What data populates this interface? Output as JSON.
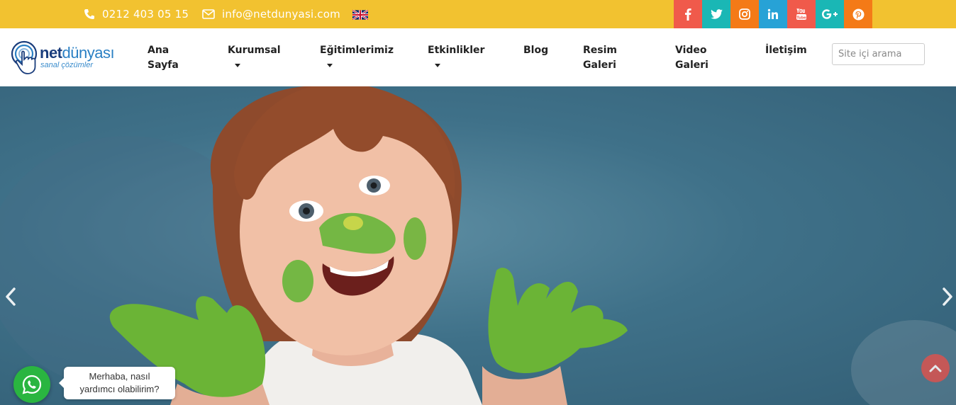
{
  "topbar": {
    "phone": "0212 403 05 15",
    "email": "info@netdunyasi.com",
    "language_flag": "uk-flag-icon",
    "socials": [
      {
        "name": "facebook",
        "glyph": "f",
        "color": "#f05a4b"
      },
      {
        "name": "twitter",
        "glyph": "t",
        "color": "#1ab7b5"
      },
      {
        "name": "instagram",
        "glyph": "i",
        "color": "#f47a17"
      },
      {
        "name": "linkedin",
        "glyph": "in",
        "color": "#27a2d6"
      },
      {
        "name": "youtube",
        "glyph": "yt",
        "color": "#f05a4b"
      },
      {
        "name": "google-plus",
        "glyph": "G+",
        "color": "#1ab7b5"
      },
      {
        "name": "pinterest",
        "glyph": "p",
        "color": "#f47a17"
      }
    ],
    "background": "#f2c230"
  },
  "logo": {
    "brand_bold": "net",
    "brand_light": "dünyası",
    "tagline": "sanal çözümler"
  },
  "nav": {
    "items": [
      {
        "line1": "Ana",
        "line2": "Sayfa",
        "dropdown": false
      },
      {
        "line1": "Kurumsal",
        "line2": "",
        "dropdown": true
      },
      {
        "line1": "Eğitimlerimiz",
        "line2": "",
        "dropdown": true
      },
      {
        "line1": "Etkinlikler",
        "line2": "",
        "dropdown": true
      },
      {
        "line1": "Blog",
        "line2": "",
        "dropdown": false
      },
      {
        "line1": "Resim",
        "line2": "Galeri",
        "dropdown": false
      },
      {
        "line1": "Video",
        "line2": "Galeri",
        "dropdown": false
      },
      {
        "line1": "İletişim",
        "line2": "",
        "dropdown": false
      }
    ]
  },
  "search": {
    "placeholder": "Site içi arama"
  },
  "whatsapp": {
    "bubble_line1": "Merhaba, nasıl",
    "bubble_line2": "yardımcı olabilirim?",
    "color": "#2ab540"
  }
}
